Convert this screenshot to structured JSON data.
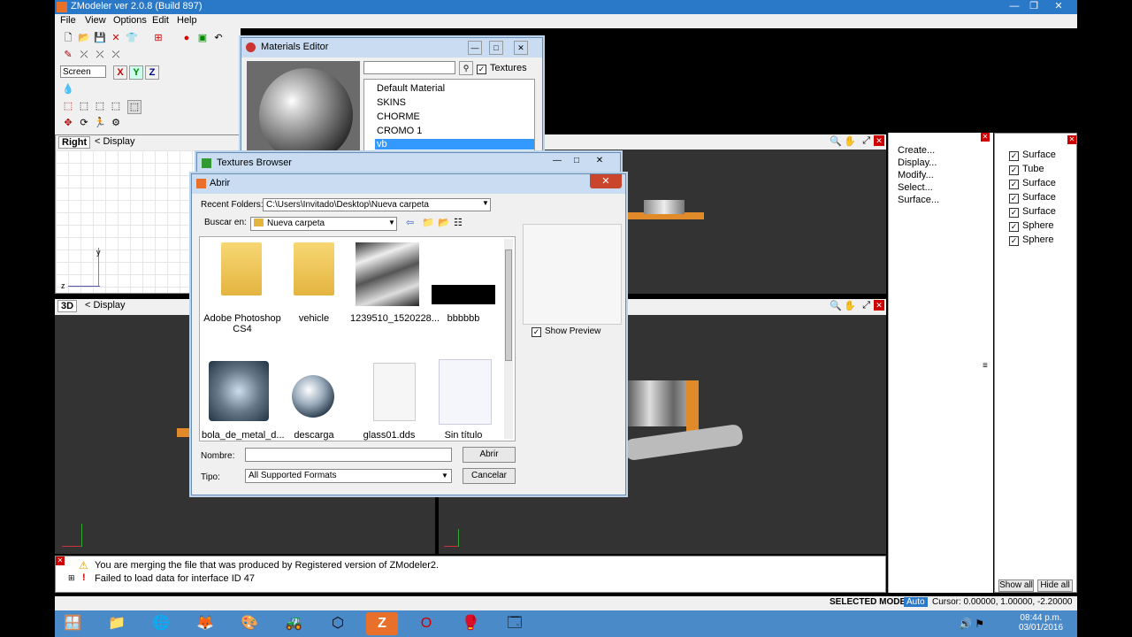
{
  "app": {
    "title": "ZModeler ver 2.0.8 (Build 897)"
  },
  "menu": [
    {
      "label": "File"
    },
    {
      "label": "View"
    },
    {
      "label": "Options"
    },
    {
      "label": "Edit"
    },
    {
      "label": "Help"
    }
  ],
  "toolbar": {
    "coord_select": "Screen",
    "axis_x": "X",
    "axis_y": "Y",
    "axis_z": "Z"
  },
  "viewports": {
    "right": {
      "tag": "Right",
      "display": "Display",
      "axis_y": "y",
      "axis_z": "z"
    },
    "three_d": {
      "tag": "3D",
      "display": "Display"
    }
  },
  "materials_editor": {
    "title": "Materials Editor",
    "textures_label": "Textures",
    "materials": [
      "Default Material",
      "SKINS",
      "CHORME",
      "CROMO 1",
      "vb"
    ],
    "selected_index": 4
  },
  "textures_browser": {
    "title": "Textures Browser"
  },
  "open_dialog": {
    "title": "Abrir",
    "recent_label": "Recent Folders:",
    "recent_value": "C:\\Users\\Invitado\\Desktop\\Nueva carpeta",
    "buscar_label": "Buscar en:",
    "buscar_value": "Nueva carpeta",
    "files": [
      "Adobe Photoshop CS4",
      "vehicle",
      "1239510_1520228...",
      "bbbbbb",
      "bola_de_metal_d...",
      "descarga",
      "glass01.dds",
      "Sin título"
    ],
    "show_preview": "Show Preview",
    "nombre_label": "Nombre:",
    "nombre_value": "",
    "tipo_label": "Tipo:",
    "tipo_value": "All Supported Formats",
    "open_button": "Abrir",
    "cancel_button": "Cancelar"
  },
  "command_panel": [
    "Create...",
    "Display...",
    "Modify...",
    "Select...",
    "Surface..."
  ],
  "objects": [
    "Surface",
    "Tube",
    "Surface",
    "Surface",
    "Surface",
    "Sphere",
    "Sphere"
  ],
  "object_buttons": {
    "show_all": "Show all",
    "hide_all": "Hide all"
  },
  "log": [
    "You are merging the file that was produced by Registered version of ZModeler2.",
    "Failed to load data for interface ID 47"
  ],
  "status": {
    "mode": "SELECTED MODE",
    "auto": "Auto",
    "cursor": "Cursor: 0.00000, 1.00000, -2.20000"
  },
  "clock": {
    "time": "08:44 p.m.",
    "date": "03/01/2016"
  }
}
